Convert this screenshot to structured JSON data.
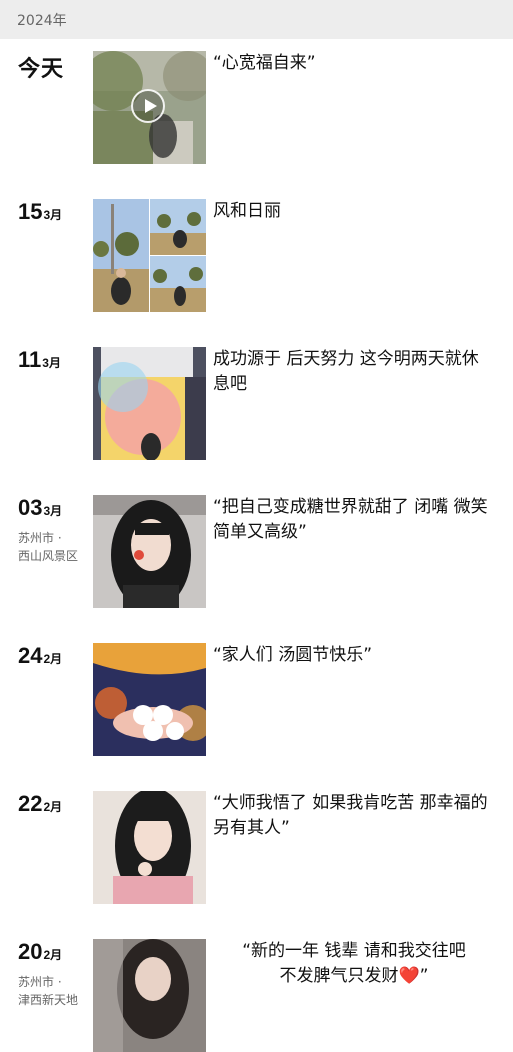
{
  "year_header": "2024年",
  "posts": [
    {
      "date_label": "今天",
      "caption": "“心宽福自来”",
      "media": "video-thumbnail"
    },
    {
      "day": "15",
      "month": "3月",
      "caption": "风和日丽",
      "media": "photo-grid-3"
    },
    {
      "day": "11",
      "month": "3月",
      "caption": "成功源于 后天努力 这今明两天就休息吧",
      "media": "photo"
    },
    {
      "day": "03",
      "month": "3月",
      "location_line1": "苏州市 ·",
      "location_line2": "西山风景区",
      "caption": "“把自己变成糖世界就甜了 闭嘴 微笑 简单又高级”",
      "media": "photo"
    },
    {
      "day": "24",
      "month": "2月",
      "caption": "“家人们 汤圆节快乐”",
      "media": "photo"
    },
    {
      "day": "22",
      "month": "2月",
      "caption": "“大师我悟了 如果我肯吃苦 那幸福的另有其人”",
      "media": "photo"
    },
    {
      "day": "20",
      "month": "2月",
      "location_line1": "苏州市 ·",
      "location_line2": "津西新天地",
      "caption_line1": "“新的一年  钱辈  请和我交往吧",
      "caption_line2": "不发脾气只发财",
      "caption_emoji": "❤️",
      "caption_end": "”",
      "media": "photo"
    }
  ]
}
